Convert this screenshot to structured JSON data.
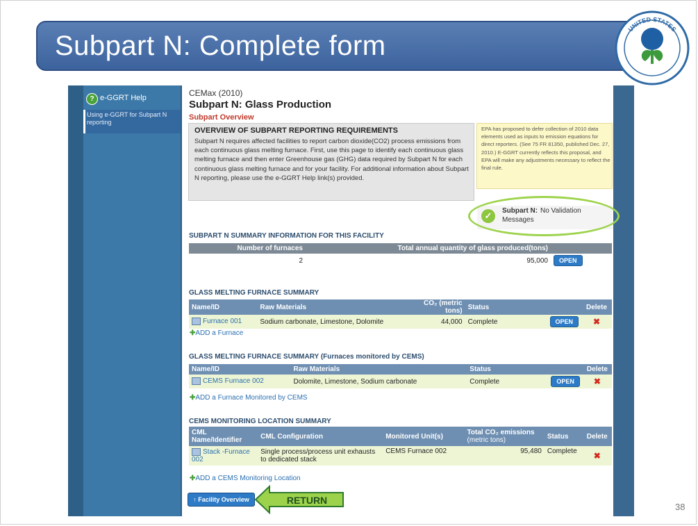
{
  "slide": {
    "title": "Subpart N:  Complete form",
    "page_number": "38",
    "return_label": "RETURN"
  },
  "sidebar": {
    "help_label": "e-GGRT Help",
    "help_link": "Using e-GGRT for Subpart N reporting"
  },
  "header": {
    "facility": "CEMax (2010)",
    "title": "Subpart N: Glass Production",
    "subtitle": "Subpart Overview"
  },
  "overview": {
    "heading": "OVERVIEW OF SUBPART REPORTING REQUIREMENTS",
    "body": "Subpart N requires affected facilities to report carbon dioxide(CO2) process emissions from each continuous glass melting furnace. First, use this page to identify each continuous glass melting furnace and then enter Greenhouse gas (GHG) data required by Subpart N for each continuous glass melting furnace and for your facility. For additional information about Subpart N reporting, please use the e-GGRT Help link(s) provided."
  },
  "notice": {
    "text": "EPA has proposed to defer collection of 2010 data elements used as inputs to emission equations for direct reporters. (See 75 FR 81350, published Dec. 27, 2010.) E-GGRT currently reflects this proposal, and EPA will make any adjustments necessary to reflect the final rule."
  },
  "validation": {
    "label": "Subpart N:",
    "message_line1": "No Validation",
    "message_line2": "Messages"
  },
  "summary": {
    "heading": "SUBPART N SUMMARY INFORMATION FOR THIS FACILITY",
    "columns": [
      "Number of furnaces",
      "Total annual quantity of glass produced(tons)"
    ],
    "furnaces": "2",
    "glass_produced": "95,000",
    "open_label": "OPEN"
  },
  "furnace_summary": {
    "heading": "GLASS MELTING FURNACE SUMMARY",
    "columns": [
      "Name/ID",
      "Raw Materials",
      "CO₂ (metric tons)",
      "Status",
      "",
      "Delete"
    ],
    "rows": [
      {
        "name": "Furnace 001",
        "materials": "Sodium carbonate, Limestone, Dolomite",
        "co2": "44,000",
        "status": "Complete",
        "open": "OPEN"
      }
    ],
    "add_label": "ADD a Furnace"
  },
  "cems_furnace_summary": {
    "heading": "GLASS MELTING FURNACE SUMMARY (Furnaces monitored by CEMS)",
    "columns": [
      "Name/ID",
      "Raw Materials",
      "Status",
      "",
      "Delete"
    ],
    "rows": [
      {
        "name": "CEMS Furnace 002",
        "materials": "Dolomite, Limestone, Sodium carbonate",
        "status": "Complete",
        "open": "OPEN"
      }
    ],
    "add_label": "ADD a Furnace Monitored by CEMS"
  },
  "cml_summary": {
    "heading": "CEMS MONITORING LOCATION SUMMARY",
    "columns": [
      "CML Name/Identifier",
      "CML Configuration",
      "Monitored Unit(s)",
      "Total CO₂ emissions",
      "(metric tons)",
      "Status",
      "Delete"
    ],
    "rows": [
      {
        "name": "Stack -Furnace 002",
        "config": "Single process/process unit exhausts to dedicated stack",
        "unit": "CEMS Furnace 002",
        "co2": "95,480",
        "status": "Complete"
      }
    ],
    "add_label": "ADD a CEMS Monitoring Location"
  },
  "footer": {
    "facility_overview": "↑ Facility Overview"
  },
  "colors": {
    "title_bar": "#3d639e",
    "header_row": "#6e8fb2",
    "row_highlight": "#edf5d4",
    "open_button": "#2d7bc7",
    "validation_ring": "#9dd34c",
    "return_arrow": "#9dd34c"
  }
}
